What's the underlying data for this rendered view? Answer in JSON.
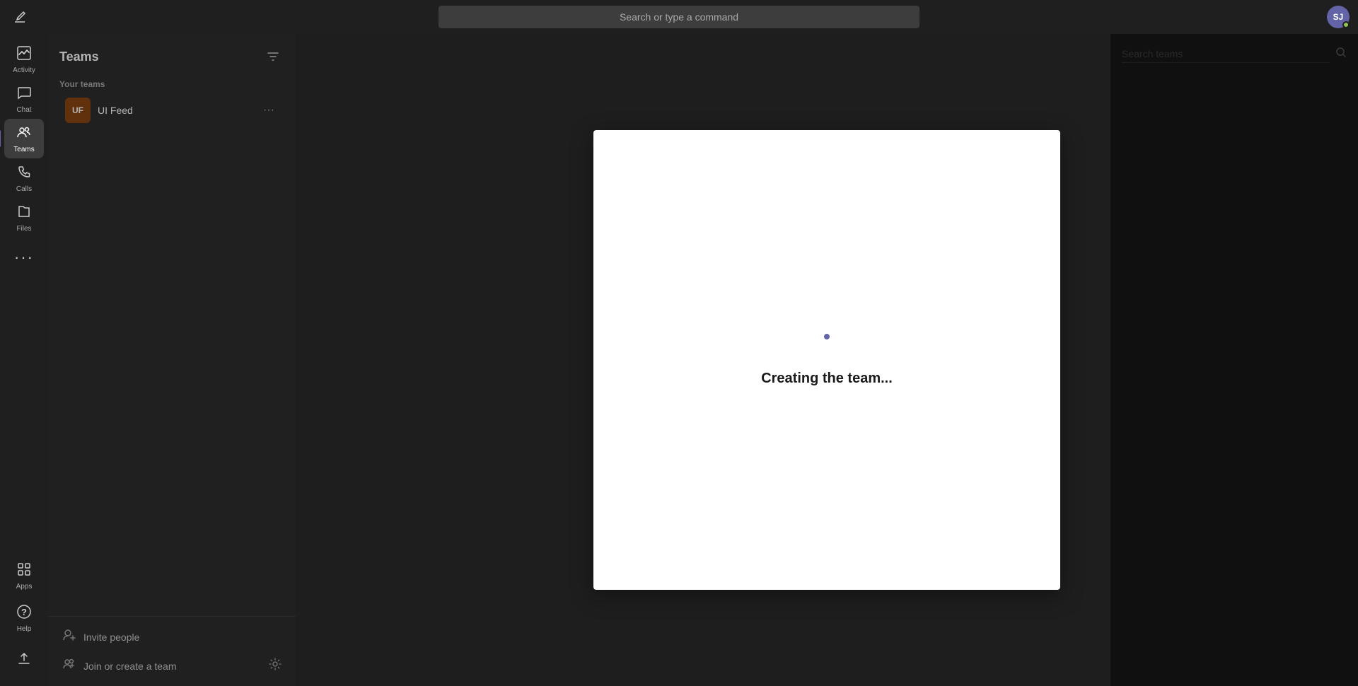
{
  "topBar": {
    "searchPlaceholder": "Search or type a command",
    "avatar": {
      "initials": "SJ",
      "label": "SJ"
    },
    "composeIcon": "✏"
  },
  "sidebar": {
    "items": [
      {
        "id": "activity",
        "label": "Activity",
        "icon": "🔔",
        "active": false
      },
      {
        "id": "chat",
        "label": "Chat",
        "icon": "💬",
        "active": false
      },
      {
        "id": "teams",
        "label": "Teams",
        "icon": "👥",
        "active": true
      },
      {
        "id": "calls",
        "label": "Calls",
        "icon": "📞",
        "active": false
      },
      {
        "id": "files",
        "label": "Files",
        "icon": "📁",
        "active": false
      },
      {
        "id": "more",
        "label": "...",
        "icon": "···",
        "active": false
      }
    ],
    "bottomItems": [
      {
        "id": "apps",
        "label": "Apps",
        "icon": "⊞"
      },
      {
        "id": "help",
        "label": "Help",
        "icon": "?"
      }
    ]
  },
  "teamsPanel": {
    "title": "Teams",
    "filterIcon": "filter",
    "yourTeamsLabel": "Your teams",
    "teams": [
      {
        "id": "ui-feed",
        "initials": "UF",
        "name": "UI Feed",
        "avatarColor": "#8b4513"
      }
    ],
    "bottomActions": [
      {
        "id": "invite-people",
        "label": "Invite people",
        "icon": "👤+"
      },
      {
        "id": "join-create",
        "label": "Join or create a team",
        "icon": "👥+",
        "showSettings": true
      }
    ]
  },
  "rightPanel": {
    "searchPlaceholder": "Search teams",
    "searchIcon": "🔍"
  },
  "modal": {
    "creatingText": "Creating the team...",
    "spinnerColor": "#6264a7"
  }
}
